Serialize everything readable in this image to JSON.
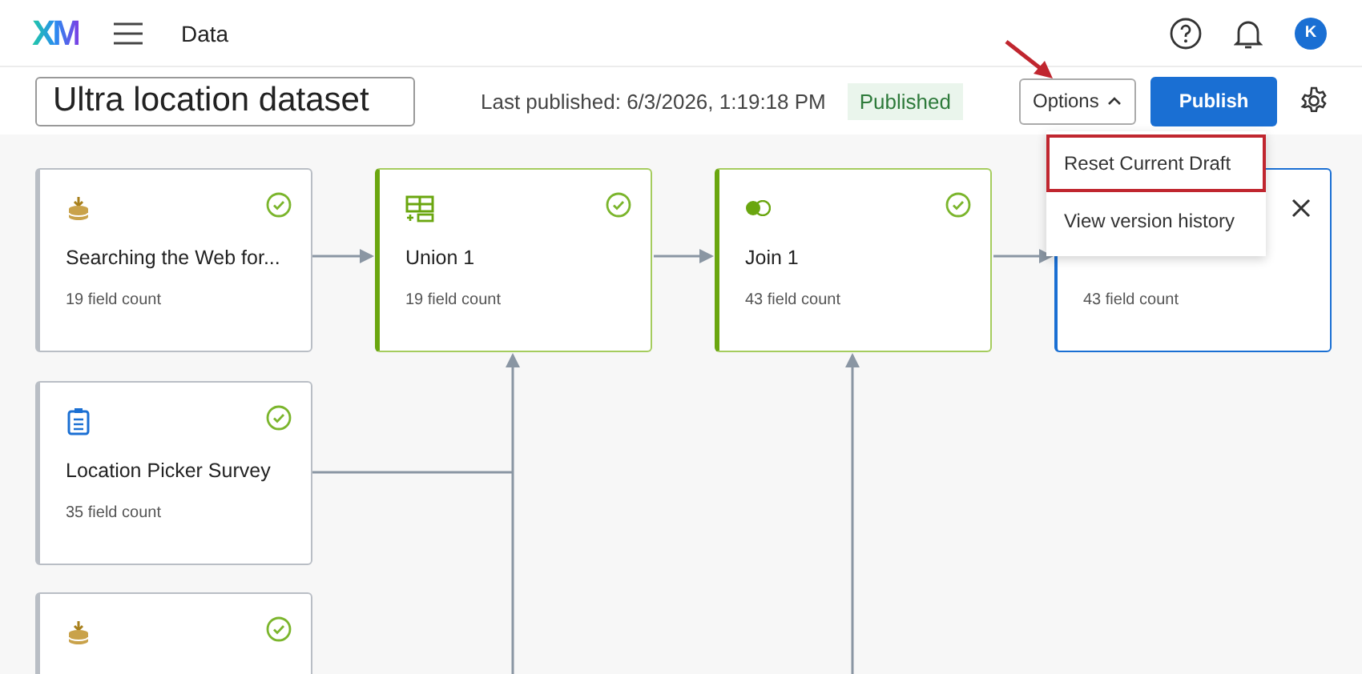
{
  "top_bar": {
    "logo": "XM",
    "section": "Data",
    "avatar": "K"
  },
  "header": {
    "dataset_name": "Ultra location dataset",
    "last_published": "Last published: 6/3/2026, 1:19:18 PM",
    "status_badge": "Published",
    "options_button": {
      "label": "Options",
      "expanded": true
    },
    "publish_button": "Publish"
  },
  "options_menu": [
    {
      "label": "Reset Current Draft",
      "highlighted": true
    },
    {
      "label": "View version history",
      "highlighted": false
    }
  ],
  "cards": [
    {
      "kind": "source",
      "title": "Searching the Web for...",
      "count": "19 field count",
      "complete": true
    },
    {
      "kind": "union",
      "title": "Union 1",
      "count": "19 field count",
      "complete": true
    },
    {
      "kind": "join",
      "title": "Join 1",
      "count": "43 field count",
      "complete": true
    },
    {
      "kind": "output",
      "count": "43 field count",
      "complete": false
    },
    {
      "kind": "survey",
      "title": "Location Picker Survey",
      "count": "35 field count",
      "complete": true
    },
    {
      "kind": "source",
      "complete": true
    }
  ]
}
